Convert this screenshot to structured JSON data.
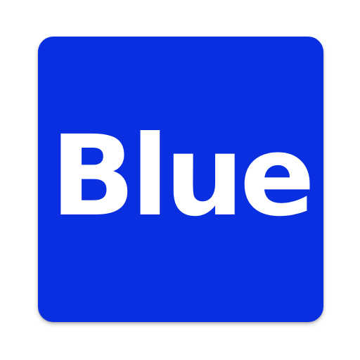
{
  "icon": {
    "label": "Blue",
    "background_color": "#0a2fe0",
    "text_color": "#ffffff"
  }
}
